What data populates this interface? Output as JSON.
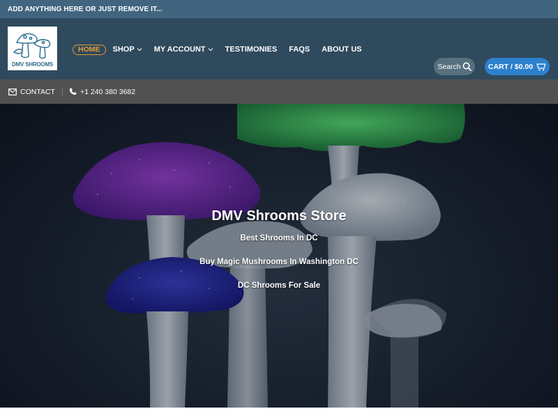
{
  "top_bar": {
    "text": "ADD ANYTHING HERE OR JUST REMOVE IT..."
  },
  "logo": {
    "text": "DMV SHROOMS",
    "icon": "mushrooms-logo-icon"
  },
  "nav": {
    "items": [
      {
        "label": "HOME",
        "active": true,
        "has_dropdown": false
      },
      {
        "label": "SHOP",
        "active": false,
        "has_dropdown": true
      },
      {
        "label": "MY ACCOUNT",
        "active": false,
        "has_dropdown": true
      },
      {
        "label": "TESTIMONIES",
        "active": false,
        "has_dropdown": false
      },
      {
        "label": "FAQS",
        "active": false,
        "has_dropdown": false
      },
      {
        "label": "ABOUT US",
        "active": false,
        "has_dropdown": false
      }
    ]
  },
  "search": {
    "label": "Search",
    "icon": "search-icon"
  },
  "cart": {
    "label": "CART / $0.00",
    "icon": "cart-icon"
  },
  "contact_bar": {
    "contact_label": "CONTACT",
    "contact_icon": "envelope-icon",
    "phone": "+1 240 380 3682",
    "phone_icon": "phone-icon"
  },
  "hero": {
    "title": "DMV Shrooms Store",
    "lines": [
      "Best Shrooms In DC",
      "Buy Magic Mushrooms In Washington DC",
      "DC Shrooms For Sale"
    ]
  },
  "colors": {
    "top_bar": "#41657f",
    "header": "#2f4a5d",
    "contact_bar": "#515151",
    "accent": "#e59a33",
    "cart": "#2c80cd"
  }
}
